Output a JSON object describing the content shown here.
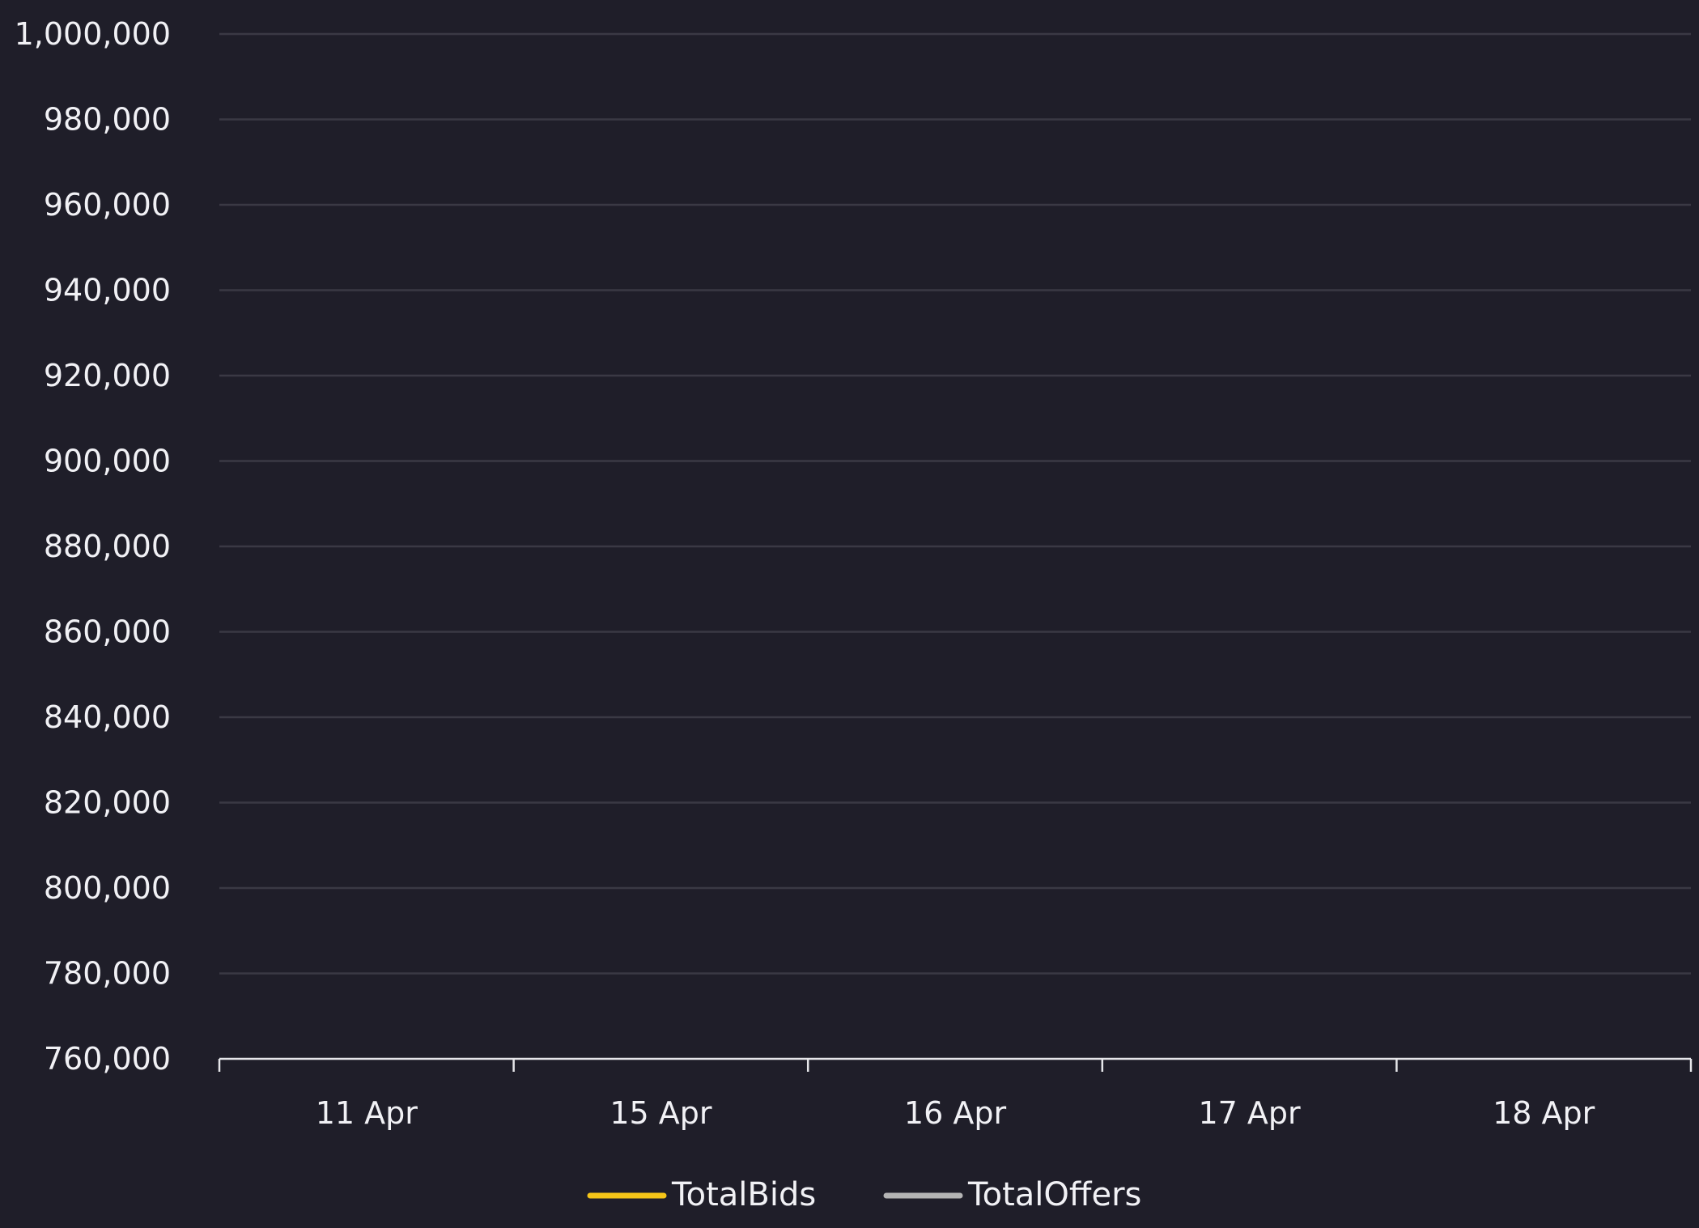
{
  "chart_data": {
    "type": "line",
    "categories": [
      "11 Apr",
      "15 Apr",
      "16 Apr",
      "17 Apr",
      "18 Apr"
    ],
    "y_ticks": [
      "1,000,000",
      "980,000",
      "960,000",
      "940,000",
      "920,000",
      "900,000",
      "880,000",
      "860,000",
      "840,000",
      "820,000",
      "800,000",
      "780,000",
      "760,000"
    ],
    "ylim": [
      760000,
      1000000
    ],
    "series": [
      {
        "name": "TotalBids",
        "color": "#f5c518",
        "values": []
      },
      {
        "name": "TotalOffers",
        "color": "#b4b4b4",
        "values": []
      }
    ],
    "grid": true,
    "legend_position": "bottom-center",
    "colors": {
      "background": "#1f1e29",
      "gridline": "#3a3944",
      "axis": "#e6e6ea",
      "text": "#f1f1f5"
    }
  }
}
